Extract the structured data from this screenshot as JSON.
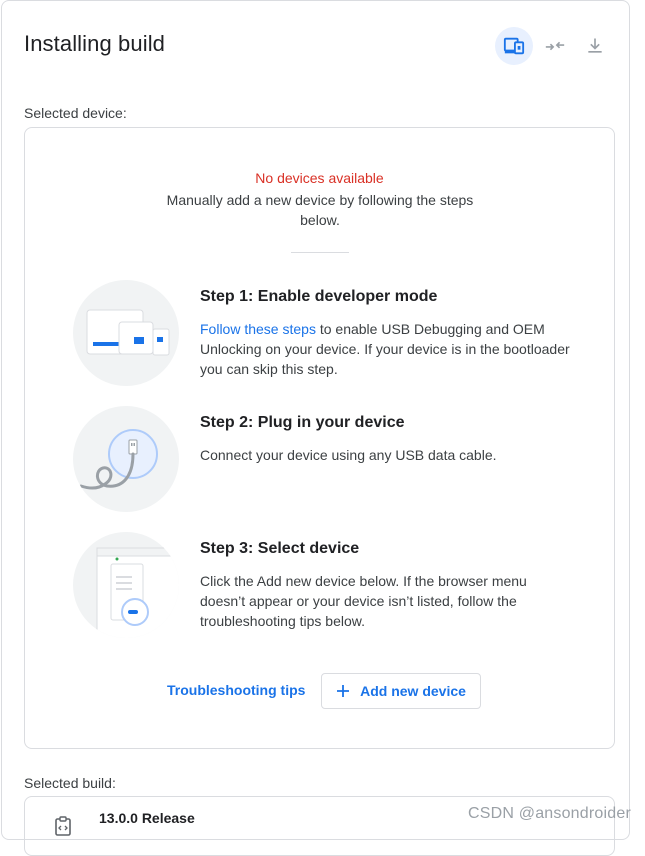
{
  "header": {
    "title": "Installing build",
    "actions": [
      {
        "icon": "device-selection-icon",
        "active": true
      },
      {
        "icon": "connect-arrows-icon",
        "active": false
      },
      {
        "icon": "download-icon",
        "active": false
      }
    ]
  },
  "device_section": {
    "label": "Selected device:",
    "status": "No devices available",
    "instructions": "Manually add a new device by following the steps below.",
    "steps": [
      {
        "title": "Step 1: Enable developer mode",
        "link_text": "Follow these steps",
        "description": " to enable USB Debugging and OEM Unlocking on your device. If your device is in the bootloader you can skip this step."
      },
      {
        "title": "Step 2: Plug in your device",
        "description": "Connect your device using any USB data cable."
      },
      {
        "title": "Step 3: Select device",
        "description": "Click the Add new device below. If the browser menu doesn’t appear or your device isn’t listed, follow the troubleshooting tips below."
      }
    ],
    "troubleshooting_label": "Troubleshooting tips",
    "add_device_label": "Add new device"
  },
  "build_section": {
    "label": "Selected build:",
    "build_name": "13.0.0 Release"
  },
  "watermark": "CSDN @ansondroider",
  "colors": {
    "accent": "#1a73e8",
    "error": "#d93025",
    "border": "#dadce0",
    "illustration_bg": "#f1f3f4"
  }
}
